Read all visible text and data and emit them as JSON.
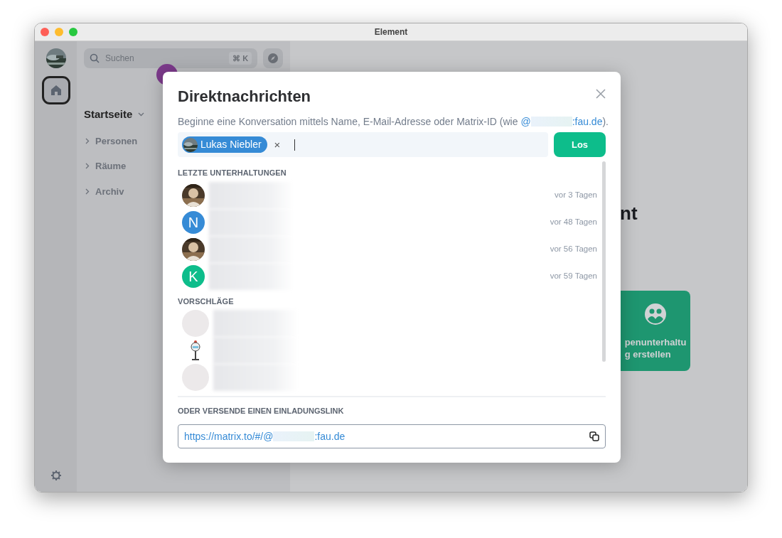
{
  "window": {
    "title": "Element"
  },
  "spaces_bar": {
    "home": {
      "selected": true
    }
  },
  "room_list": {
    "search": {
      "placeholder": "Suchen",
      "shortcut": "⌘ K"
    },
    "header": "Startseite",
    "sections": [
      {
        "label": "Personen",
        "expanded": false
      },
      {
        "label": "Räume",
        "expanded": false
      },
      {
        "label": "Archiv",
        "expanded": false
      }
    ]
  },
  "background": {
    "heading_fragment": "nt",
    "card_lines": [
      "penunterhaltu",
      "g erstellen"
    ]
  },
  "dialog": {
    "title": "Direktnachrichten",
    "description": "Beginne eine Konversation mittels Name, E-Mail-Adresse oder Matrix-ID (wie ",
    "example_prefix": "@",
    "example_suffix": ":fau.de",
    "description_end": ").",
    "chip": {
      "name": "Lukas Niebler",
      "remove": "×"
    },
    "go_button": "Los",
    "recent": {
      "heading": "LETZTE UNTERHALTUNGEN",
      "rows": [
        {
          "time": "vor 3 Tagen"
        },
        {
          "avatar": {
            "kind": "letter",
            "letter": "N",
            "color": "#368bd6"
          },
          "time": "vor 48 Tagen"
        },
        {
          "time": "vor 56 Tagen"
        },
        {
          "avatar": {
            "kind": "letter",
            "letter": "K",
            "color": "#0dbd8b"
          },
          "time": "vor 59 Tagen"
        }
      ]
    },
    "suggestions": {
      "heading": "VORSCHLÄGE",
      "rows": [
        {
          "avatar": {
            "kind": "blank"
          }
        },
        {
          "avatar": {
            "kind": "figure"
          }
        },
        {
          "avatar": {
            "kind": "blank"
          }
        }
      ]
    },
    "invite": {
      "heading": "ODER VERSENDE EINEN EINLADUNGSLINK",
      "prefix": "https://matrix.to/#/@",
      "suffix": ":fau.de"
    }
  }
}
